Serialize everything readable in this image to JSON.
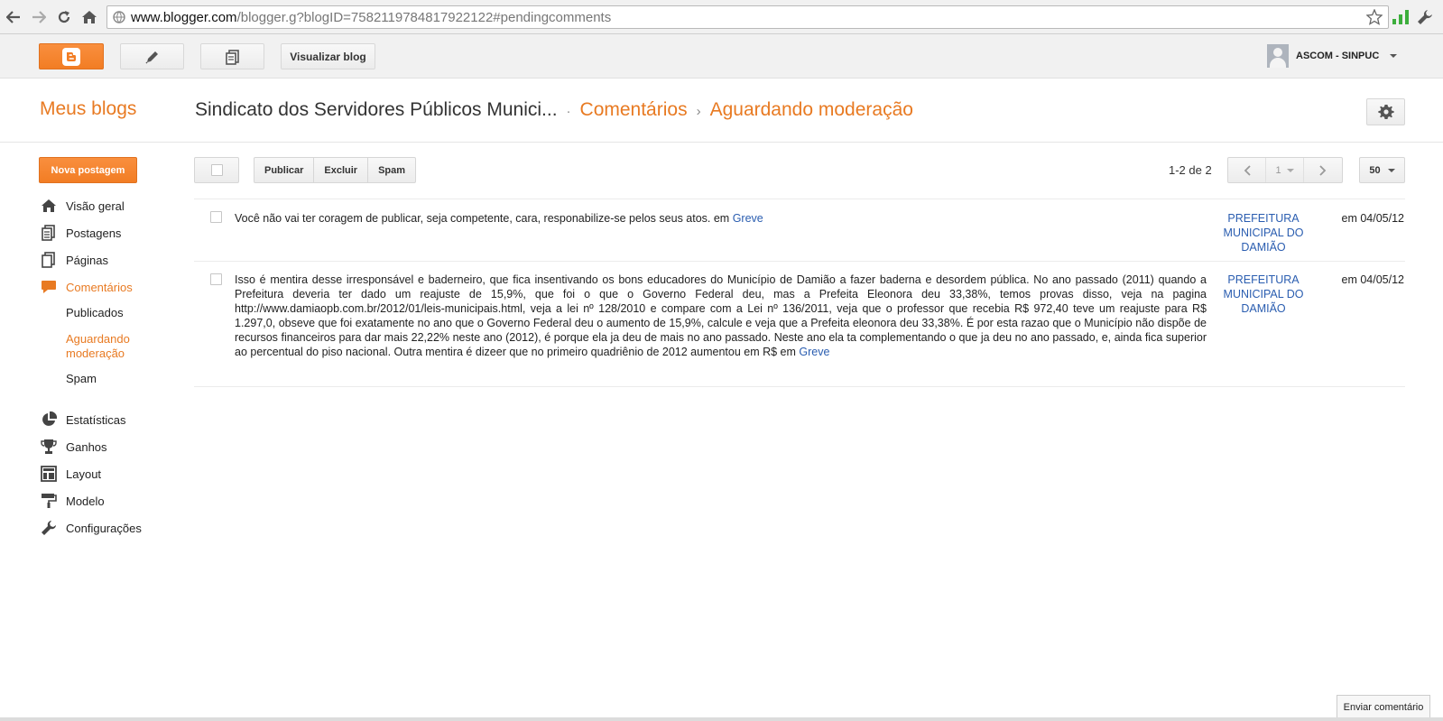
{
  "browser": {
    "url_host": "www.blogger.com",
    "url_rest": "/blogger.g?blogID=7582119784817922122#pendingcomments"
  },
  "topbar": {
    "view_blog": "Visualizar blog",
    "account_name": "ASCOM - SINPUC"
  },
  "header": {
    "my_blogs": "Meus blogs",
    "blog_title": "Sindicato dos Servidores Públicos Munici...",
    "crumb_comments": "Comentários",
    "crumb_sep": "›",
    "crumb_pending": "Aguardando moderação"
  },
  "sidebar": {
    "new_post": "Nova postagem",
    "items": [
      {
        "label": "Visão geral",
        "icon": "home-icon"
      },
      {
        "label": "Postagens",
        "icon": "posts-icon"
      },
      {
        "label": "Páginas",
        "icon": "pages-icon"
      },
      {
        "label": "Comentários",
        "icon": "comments-icon"
      },
      {
        "label": "Estatísticas",
        "icon": "stats-icon"
      },
      {
        "label": "Ganhos",
        "icon": "trophy-icon"
      },
      {
        "label": "Layout",
        "icon": "layout-icon"
      },
      {
        "label": "Modelo",
        "icon": "paint-roller-icon"
      },
      {
        "label": "Configurações",
        "icon": "wrench-icon"
      }
    ],
    "sub": {
      "published": "Publicados",
      "pending": "Aguardando moderação",
      "spam": "Spam"
    }
  },
  "toolbar": {
    "publish": "Publicar",
    "delete": "Excluir",
    "spam": "Spam",
    "count": "1-2 de 2",
    "page": "1",
    "per_page": "50"
  },
  "comments": [
    {
      "text": "Você não vai ter coragem de publicar, seja competente, cara, responabilize-se pelos seus atos. em ",
      "post": "Greve",
      "author": "PREFEITURA MUNICIPAL DO DAMIÃO",
      "date": "em 04/05/12"
    },
    {
      "text": "Isso é mentira desse irresponsável e baderneiro, que fica insentivando os bons educadores do Município de Damião a fazer baderna e desordem pública. No ano passado (2011) quando a Prefeitura deveria ter dado um reajuste de 15,9%, que foi o que o Governo Federal deu, mas a Prefeita Eleonora deu 33,38%, temos provas disso, veja na pagina http://www.damiaopb.com.br/2012/01/leis-municipais.html, veja a lei nº 128/2010 e compare com a Lei nº 136/2011, veja que o professor que recebia R$ 972,40 teve um reajuste para R$ 1.297,0, obseve que foi exatamente no ano que o Governo Federal deu o aumento de 15,9%, calcule e veja que a Prefeita eleonora deu 33,38%. É por esta razao que o Município não dispõe de recursos financeiros para dar mais 22,22% neste ano (2012), é porque ela ja deu de mais no ano passado. Neste ano ela ta complementando o que ja deu no ano passado, e, ainda fica superior ao percentual do piso nacional. Outra mentira é dizeer que no primeiro quadriênio de 2012 aumentou em R$ em ",
      "post": "Greve",
      "author": "PREFEITURA MUNICIPAL DO DAMIÃO",
      "date": "em 04/05/12"
    }
  ],
  "feedback": "Enviar comentário",
  "colors": {
    "accent": "#e87a22",
    "link": "#2a5db0"
  }
}
